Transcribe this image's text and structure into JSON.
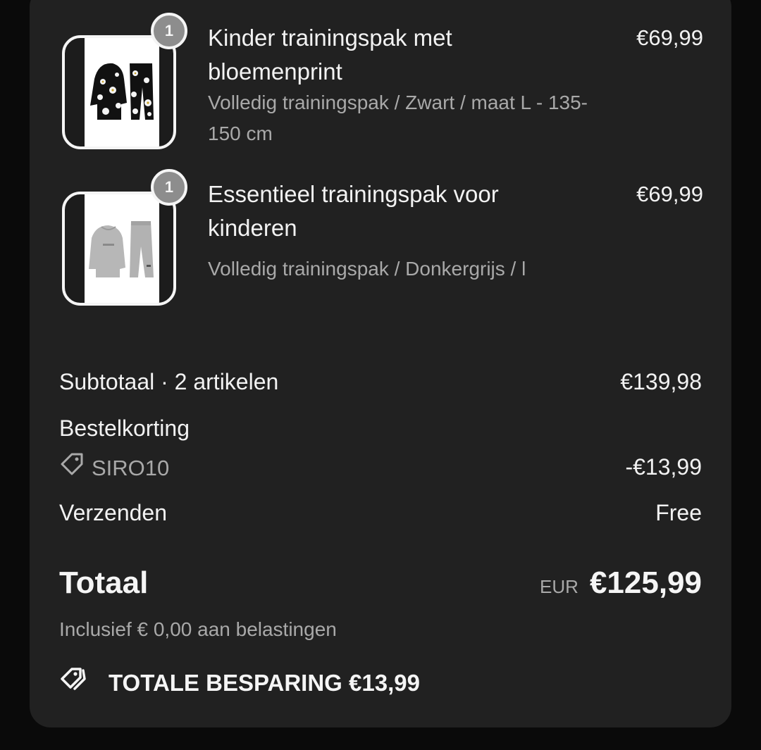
{
  "items": [
    {
      "quantity": "1",
      "title": "Kinder trainingspak met bloemenprint",
      "variant": "Volledig trainingspak / Zwart / maat L - 135-150 cm",
      "price": "€69,99",
      "image": "black-floral-tracksuit"
    },
    {
      "quantity": "1",
      "title": "Essentieel trainingspak voor kinderen",
      "variant": "Volledig trainingspak / Donkergrijs / l",
      "price": "€69,99",
      "image": "grey-tracksuit"
    }
  ],
  "summary": {
    "subtotal_label": "Subtotaal · 2 artikelen",
    "subtotal_value": "€139,98",
    "discount_label": "Bestelkorting",
    "discount_code": "SIRO10",
    "discount_value": "-€13,99",
    "shipping_label": "Verzenden",
    "shipping_value": "Free"
  },
  "total": {
    "label": "Totaal",
    "currency": "EUR",
    "value": "€125,99",
    "tax_note": "Inclusief € 0,00 aan belastingen"
  },
  "savings": {
    "label": "TOTALE BESPARING €13,99"
  },
  "colors": {
    "card_background": "#212121",
    "page_background": "#0a0a0a",
    "muted_text": "#a9a9a9",
    "badge": "#8d8d8d"
  },
  "icons": {
    "discount_tag": "tag-icon",
    "savings": "tags-icon"
  }
}
